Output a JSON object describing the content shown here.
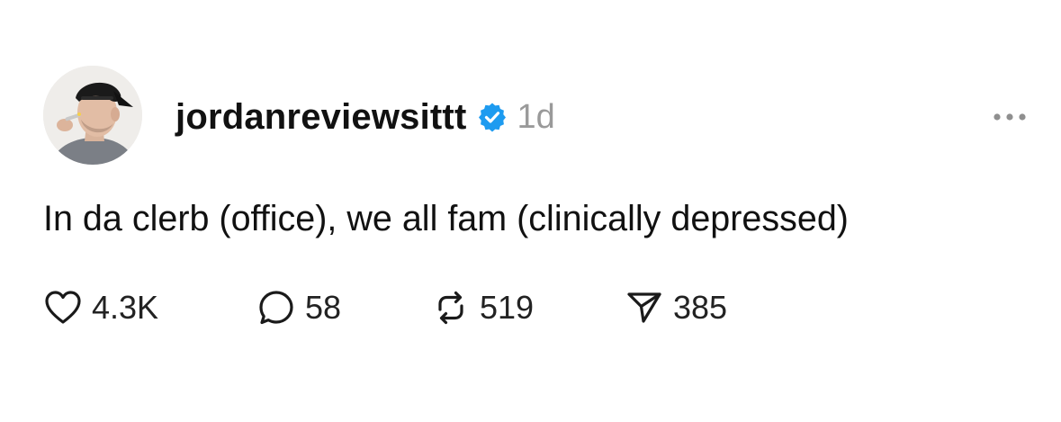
{
  "post": {
    "username": "jordanreviewsittt",
    "verified": true,
    "timestamp": "1d",
    "text": "In da clerb (office), we all fam (clinically depressed)",
    "more_icon": "ellipsis-icon",
    "accent_color": "#1d9bf0"
  },
  "actions": {
    "like": {
      "icon": "heart-icon",
      "count": "4.3K"
    },
    "reply": {
      "icon": "comment-bubble-icon",
      "count": "58"
    },
    "repost": {
      "icon": "repost-icon",
      "count": "519"
    },
    "share": {
      "icon": "send-icon",
      "count": "385"
    }
  }
}
